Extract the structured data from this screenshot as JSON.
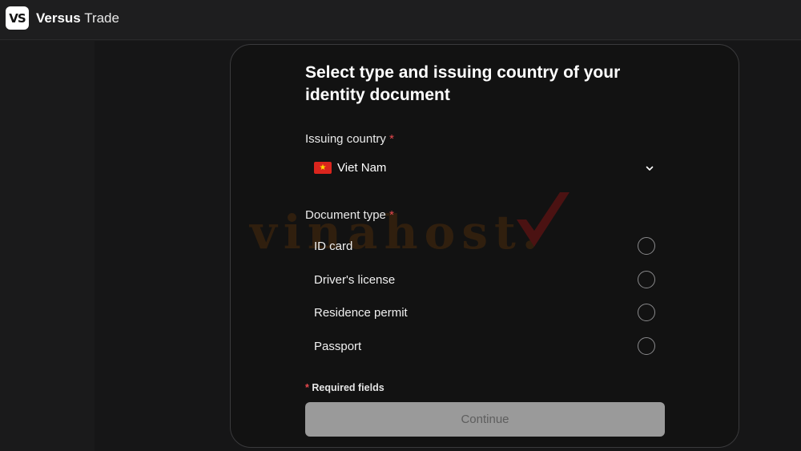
{
  "header": {
    "logo_text": "VS",
    "brand_bold": "Versus",
    "brand_light": "Trade"
  },
  "form": {
    "title": "Select type and issuing country of your identity document",
    "country_label": "Issuing country",
    "country_value": "Viet Nam",
    "required_mark": "*",
    "doc_type_label": "Document type",
    "options": [
      {
        "label": "ID card",
        "selected": false
      },
      {
        "label": "Driver's license",
        "selected": false
      },
      {
        "label": "Residence permit",
        "selected": false
      },
      {
        "label": "Passport",
        "selected": false
      }
    ],
    "required_note": "Required fields",
    "continue_label": "Continue"
  },
  "watermark": {
    "text": "vinahost."
  },
  "colors": {
    "required_red": "#e5484d",
    "button_disabled": "#9a9a9a",
    "card_bg": "#121212",
    "page_bg": "#161617"
  },
  "icons": {
    "flag": "vietnam-flag-icon",
    "dropdown": "chevron-down-icon"
  }
}
